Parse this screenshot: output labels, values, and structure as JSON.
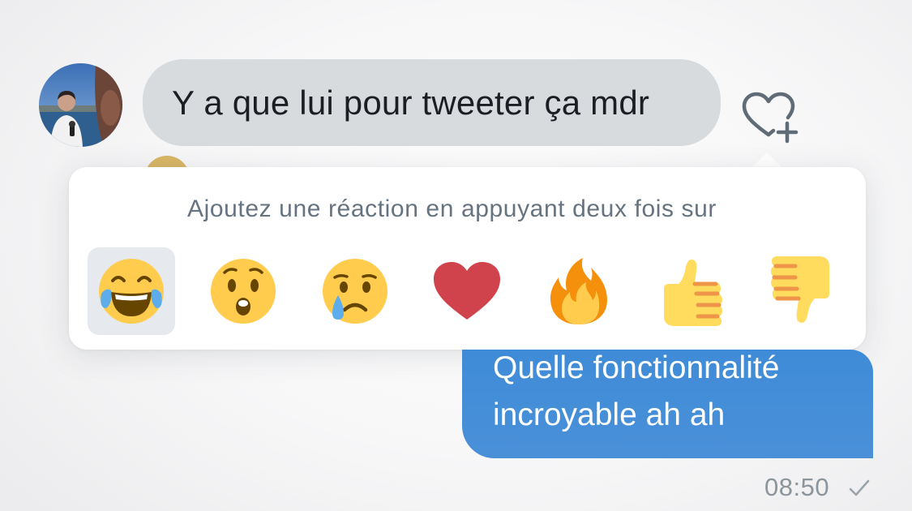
{
  "conversation": {
    "incoming_message": "Y a que lui pour tweeter ça mdr",
    "outgoing_message_line1": "Quelle fonctionnalité",
    "outgoing_message_line2": "incroyable ah ah",
    "outgoing_time": "08:50"
  },
  "reaction_picker": {
    "hint": "Ajoutez une réaction en appuyant deux fois sur",
    "reactions": [
      {
        "name": "tears-of-joy",
        "icon": "face-with-tears-of-joy-icon",
        "selected": true
      },
      {
        "name": "surprised",
        "icon": "hushed-face-icon",
        "selected": false
      },
      {
        "name": "crying",
        "icon": "crying-face-icon",
        "selected": false
      },
      {
        "name": "heart",
        "icon": "red-heart-icon",
        "selected": false
      },
      {
        "name": "fire",
        "icon": "fire-icon",
        "selected": false
      },
      {
        "name": "thumbs-up",
        "icon": "thumbs-up-icon",
        "selected": false
      },
      {
        "name": "thumbs-down",
        "icon": "thumbs-down-icon",
        "selected": false
      }
    ]
  },
  "colors": {
    "incoming_bubble": "#d8dbde",
    "outgoing_bubble": "#4a90d9",
    "hint_text": "#667380",
    "selected_reaction_bg": "#e6e9ee",
    "heart": "#d0434c"
  }
}
